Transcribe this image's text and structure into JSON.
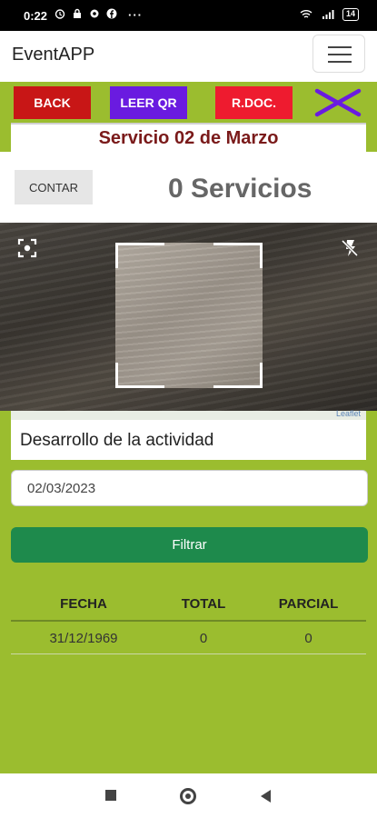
{
  "status_bar": {
    "time": "0:22",
    "dots": "···",
    "battery": "14"
  },
  "app": {
    "brand": "EventAPP"
  },
  "toolbar": {
    "back_label": "BACK",
    "qr_label": "LEER QR",
    "rdoc_label": "R.DOC."
  },
  "service": {
    "title": "Servicio 02 de Marzo"
  },
  "counter": {
    "button_label": "CONTAR",
    "count_text": "0 Servicios"
  },
  "map": {
    "attribution": "Leaflet"
  },
  "activity": {
    "label": "Desarrollo de la actividad"
  },
  "filter": {
    "date_value": "02/03/2023",
    "button_label": "Filtrar"
  },
  "table": {
    "headers": [
      "FECHA",
      "TOTAL",
      "PARCIAL"
    ],
    "rows": [
      [
        "31/12/1969",
        "0",
        "0"
      ]
    ]
  },
  "colors": {
    "page_bg": "#9bbd2f",
    "back_button": "#c81616",
    "qr_button": "#6a1be0",
    "rdoc_button": "#ee1b2f",
    "filter_button": "#1e8a4c",
    "title_text": "#7a1a1a",
    "close_icon": "#6a1be0"
  },
  "icons": [
    "alarm-icon",
    "lock-icon",
    "settings-icon",
    "facebook-icon",
    "wifi-icon",
    "signal-icon",
    "battery-icon",
    "close-x-icon",
    "scan-frame-icon",
    "flash-off-icon",
    "nav-recents-icon",
    "nav-home-icon",
    "nav-back-icon"
  ]
}
